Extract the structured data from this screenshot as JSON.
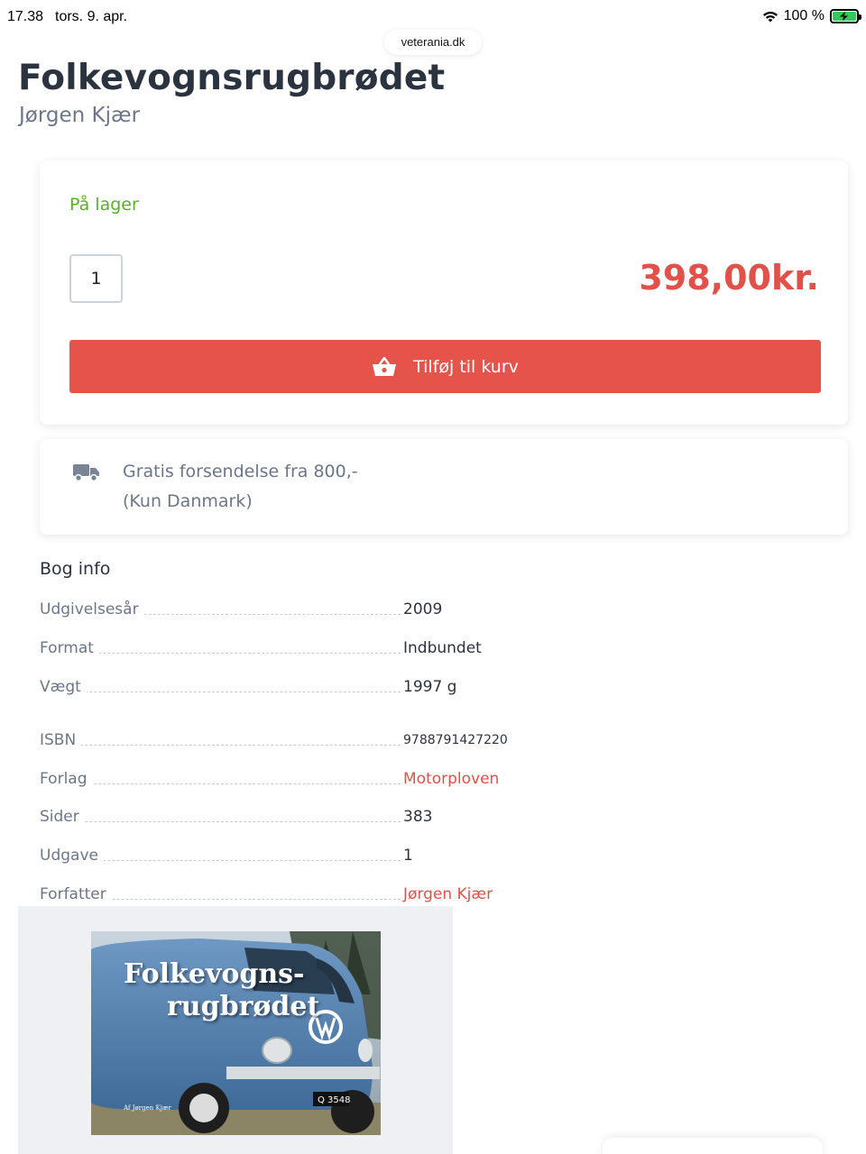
{
  "status_bar": {
    "time": "17.38",
    "date": "tors. 9. apr.",
    "battery": "100 %",
    "url": "veterania.dk"
  },
  "product": {
    "title": "Folkevognsrugbrødet",
    "author": "Jørgen Kjær",
    "stock": "På lager",
    "quantity": "1",
    "price": "398,00kr.",
    "add_to_cart": "Tilføj til kurv"
  },
  "shipping": {
    "line1": "Gratis forsendelse fra 800,-",
    "line2": "(Kun Danmark)"
  },
  "info": {
    "heading": "Bog info",
    "rows": [
      {
        "label": "Udgivelsesår",
        "value": "2009"
      },
      {
        "label": "Format",
        "value": "Indbundet"
      },
      {
        "label": "Vægt",
        "value": "1997 g"
      },
      {
        "label": "ISBN",
        "value": "9788791427220"
      },
      {
        "label": "Forlag",
        "value": "Motorploven"
      },
      {
        "label": "Sider",
        "value": "383"
      },
      {
        "label": "Udgave",
        "value": "1"
      },
      {
        "label": "Forfatter",
        "value": "Jørgen Kjær"
      }
    ]
  },
  "cover": {
    "title_line1": "Folkevogns-",
    "title_line2": "rugbrødet",
    "byline": "Af Jørgen Kjær",
    "plate": "Q 3548"
  },
  "colors": {
    "accent": "#e5534b",
    "stock_green": "#58b02a",
    "text_dark": "#2c3340",
    "text_muted": "#6b7688"
  }
}
